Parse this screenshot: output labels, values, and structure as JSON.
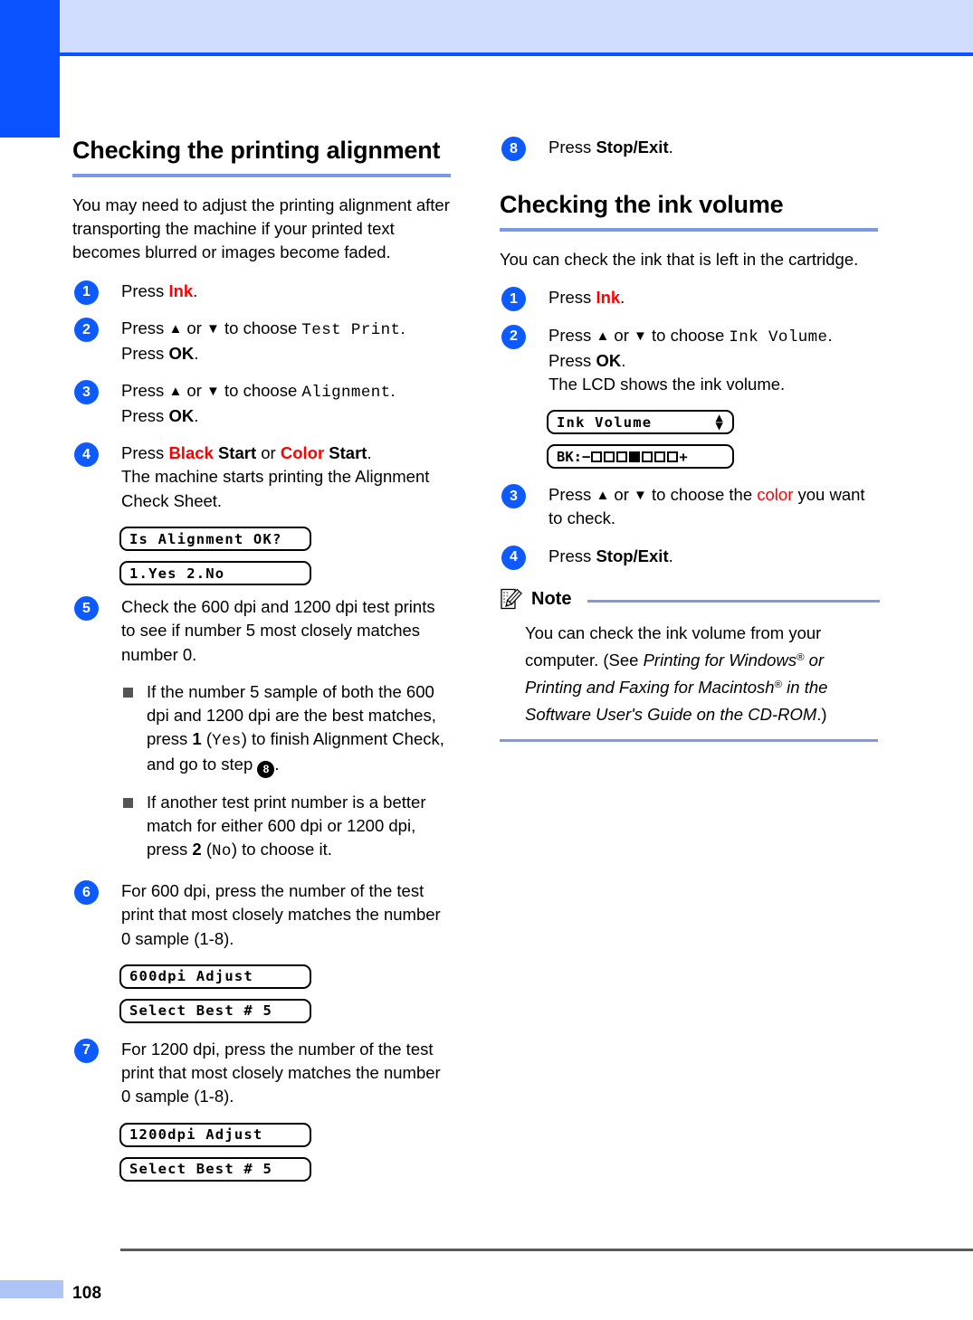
{
  "page": {
    "number": "108"
  },
  "left_column": {
    "heading": "Checking the printing alignment",
    "intro": "You may need to adjust the printing alignment after transporting the machine if your printed text becomes blurred or images become faded.",
    "steps": [
      {
        "num": "1",
        "text_before": "Press ",
        "key": "Ink",
        "text_after": "."
      },
      {
        "num": "2",
        "line1_a": "Press ",
        "line1_up": "▲",
        "line1_b": " or ",
        "line1_down": "▼",
        "line1_c": " to choose ",
        "lcd_value": "Test Print",
        "line1_d": ".",
        "line2_a": "Press ",
        "line2_key": "OK",
        "line2_b": "."
      },
      {
        "num": "3",
        "line1_a": "Press ",
        "line1_up": "▲",
        "line1_b": " or ",
        "line1_down": "▼",
        "line1_c": " to choose ",
        "lcd_value": "Alignment",
        "line1_d": ".",
        "line2_a": "Press ",
        "line2_key": "OK",
        "line2_b": "."
      },
      {
        "num": "4",
        "press": "Press ",
        "black": "Black",
        "start1": " Start",
        "or": " or ",
        "color": "Color",
        "start2": " Start",
        "period": ".",
        "line2": "The machine starts printing the Alignment Check Sheet."
      },
      {
        "num": "5",
        "text": "Check the 600 dpi and 1200 dpi test prints to see if number 5 most closely matches number 0."
      },
      {
        "num": "6",
        "text": "For 600 dpi, press the number of the test print that most closely matches the number 0 sample (1-8)."
      },
      {
        "num": "7",
        "text": "For 1200 dpi, press the number of the test print that most closely matches the number 0 sample (1-8)."
      }
    ],
    "bullets": [
      {
        "a": "If the number 5 sample of both the 600 dpi and 1200 dpi are the best matches, press ",
        "key": "1",
        "b": " (",
        "mono": "Yes",
        "c": ") to finish Alignment Check, and go to step ",
        "stepref": "8",
        "d": "."
      },
      {
        "a": "If another test print number is a better match for either 600 dpi or 1200 dpi, press ",
        "key": "2",
        "b": " (",
        "mono": "No",
        "c": ") to choose it.",
        "stepref": "",
        "d": ""
      }
    ],
    "lcd_screens": {
      "is_alignment_ok": "Is Alignment OK?",
      "yes_no": "1.Yes 2.No",
      "adjust_600": "600dpi Adjust",
      "select_best_600": "Select Best # 5",
      "adjust_1200": "1200dpi Adjust",
      "select_best_1200": "Select Best # 5"
    }
  },
  "right_column": {
    "step8": {
      "num": "8",
      "text_before": "Press ",
      "key": "Stop/Exit",
      "text_after": "."
    },
    "heading": "Checking the ink volume",
    "intro": "You can check the ink that is left in the cartridge.",
    "steps": [
      {
        "num": "1",
        "text_before": "Press ",
        "key": "Ink",
        "text_after": "."
      },
      {
        "num": "2",
        "line1_a": "Press ",
        "line1_up": "▲",
        "line1_b": " or ",
        "line1_down": "▼",
        "line1_c": " to choose ",
        "lcd_value": "Ink Volume",
        "line1_d": ".",
        "line2_a": "Press ",
        "line2_key": "OK",
        "line2_b": ".",
        "line3": "The LCD shows the ink volume."
      },
      {
        "num": "3",
        "a": "Press ",
        "up": "▲",
        "b": " or ",
        "down": "▼",
        "c": " to choose the ",
        "color_word": "color",
        "d": " you want to check."
      },
      {
        "num": "4",
        "text_before": "Press ",
        "key": "Stop/Exit",
        "text_after": "."
      }
    ],
    "lcd_screens": {
      "ink_volume_label": "Ink Volume",
      "ink_volume_arrows": "▲▼",
      "ink_bar_prefix": "BK:−",
      "ink_bar_suffix": "+",
      "ink_bar_total_squares": 7,
      "ink_bar_filled_index": 4
    },
    "note": {
      "icon": "note-pencil-icon",
      "title": "Note",
      "text_1": "You can check the ink volume from your computer. (See ",
      "italic_1": "Printing for Windows",
      "sup_1": "®",
      "italic_1b": " or ",
      "italic_2": "Printing and Faxing for Macintosh",
      "sup_2": "®",
      "italic_2b": " in the Software User's Guide on the CD-ROM",
      "text_end": ".)"
    }
  },
  "colors": {
    "accent_blue": "#0a51ff",
    "header_band": "#cfdcfb",
    "rule_blue": "#7b9ae6",
    "step_circle": "#0d5bff",
    "key_red": "#ff0000",
    "footer_bar": "#aec4f5"
  }
}
